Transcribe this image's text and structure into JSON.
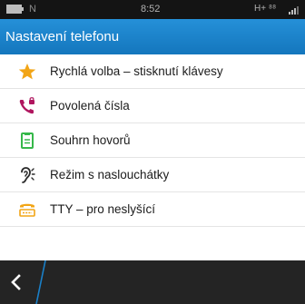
{
  "status_bar": {
    "left_indicator": "N",
    "time": "8:52",
    "network": "H+ ⁸⁸",
    "icon_battery": "battery-icon",
    "icon_signal": "signal-icon"
  },
  "header": {
    "title": "Nastavení telefonu",
    "background": "#1a80c8"
  },
  "list": {
    "items": [
      {
        "label": "Rychlá volba – stisknutí klávesy",
        "icon": "star-icon",
        "color": "#f2a516"
      },
      {
        "label": "Povolená čísla",
        "icon": "phone-lock-icon",
        "color": "#b0165f"
      },
      {
        "label": "Souhrn hovorů",
        "icon": "call-log-icon",
        "color": "#36b84a"
      },
      {
        "label": "Režim s naslouchátky",
        "icon": "hearing-aid-icon",
        "color": "#2a2a2a"
      },
      {
        "label": "TTY – pro neslyšící",
        "icon": "tty-icon",
        "color": "#f2a516"
      }
    ]
  },
  "bottom_bar": {
    "back_icon": "chevron-left-icon",
    "accent": "#1a80c8"
  }
}
